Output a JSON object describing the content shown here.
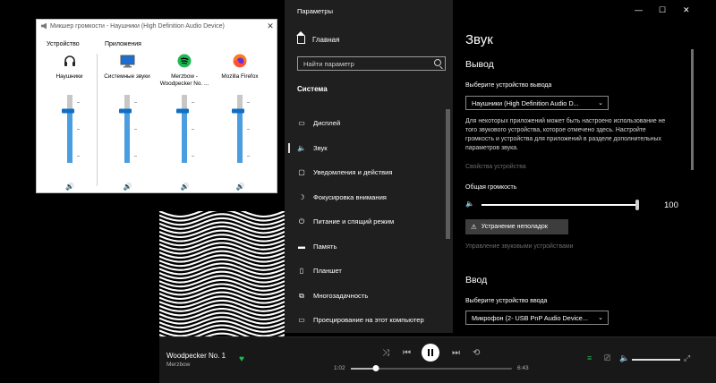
{
  "mixer": {
    "title": "Микшер громкости - Наушники (High Definition Audio Device)",
    "close": "✕",
    "device_header": "Устройство",
    "apps_header": "Приложения",
    "channels": [
      {
        "label": "Наушники",
        "icon": "headphones-icon",
        "level": 0.76
      },
      {
        "label": "Системные звуки",
        "icon": "system-sounds-icon",
        "level": 0.76
      },
      {
        "label": "Merzbow - Woodpecker No. ...",
        "icon": "spotify-icon",
        "level": 0.76
      },
      {
        "label": "Mozilla Firefox",
        "icon": "firefox-icon",
        "level": 0.76
      }
    ],
    "speaker_glyph": "🔊"
  },
  "settings": {
    "window_title": "Параметры",
    "controls": {
      "minimize": "—",
      "maximize": "☐",
      "close": "✕"
    },
    "home": "Главная",
    "search_placeholder": "Найти параметр",
    "section": "Система",
    "nav": [
      {
        "label": "Дисплей",
        "icon": "display-icon",
        "glyph": "▭"
      },
      {
        "label": "Звук",
        "icon": "speaker-icon",
        "glyph": "🔈",
        "selected": true
      },
      {
        "label": "Уведомления и действия",
        "icon": "notifications-icon",
        "glyph": "▢"
      },
      {
        "label": "Фокусировка внимания",
        "icon": "focus-assist-icon",
        "glyph": "☽"
      },
      {
        "label": "Питание и спящий режим",
        "icon": "power-icon",
        "glyph": "⏻"
      },
      {
        "label": "Память",
        "icon": "storage-icon",
        "glyph": "▬"
      },
      {
        "label": "Планшет",
        "icon": "tablet-icon",
        "glyph": "▯"
      },
      {
        "label": "Многозадачность",
        "icon": "multitasking-icon",
        "glyph": "⧉"
      },
      {
        "label": "Проецирование на этот компьютер",
        "icon": "projecting-icon",
        "glyph": "▭"
      }
    ],
    "page_title": "Звук",
    "output_header": "Вывод",
    "output_select_label": "Выберите устройство вывода",
    "output_device": "Наушники (High Definition Audio D...",
    "output_desc": "Для некоторых приложений может быть настроено использование не того звукового устройства, которое отмечено здесь. Настройте громкость и устройства для приложений в разделе дополнительных параметров звука.",
    "device_props_link": "Свойства устройства",
    "master_volume_label": "Общая громкость",
    "master_volume": 100,
    "troubleshoot_button": "Устранение неполадок",
    "manage_devices_link": "Управление звуковыми устройствами",
    "input_header": "Ввод",
    "input_select_label": "Выберите устройство ввода",
    "input_device": "Микрофон (2- USB PnP Audio Device...",
    "dropdown_chevron": "⌄"
  },
  "player": {
    "track": "Woodpecker No. 1",
    "artist": "Merzbow",
    "current_time": "1:02",
    "total_time": "6:43",
    "progress": 0.154,
    "volume": 1.0,
    "accent": "#1db954",
    "glyphs": {
      "heart": "♥",
      "shuffle": "⤨",
      "prev": "⏮",
      "next": "⏭",
      "repeat": "⟲",
      "queue": "≡",
      "devices": "⎚",
      "volume": "🔈",
      "fullscreen": "⤢"
    }
  }
}
